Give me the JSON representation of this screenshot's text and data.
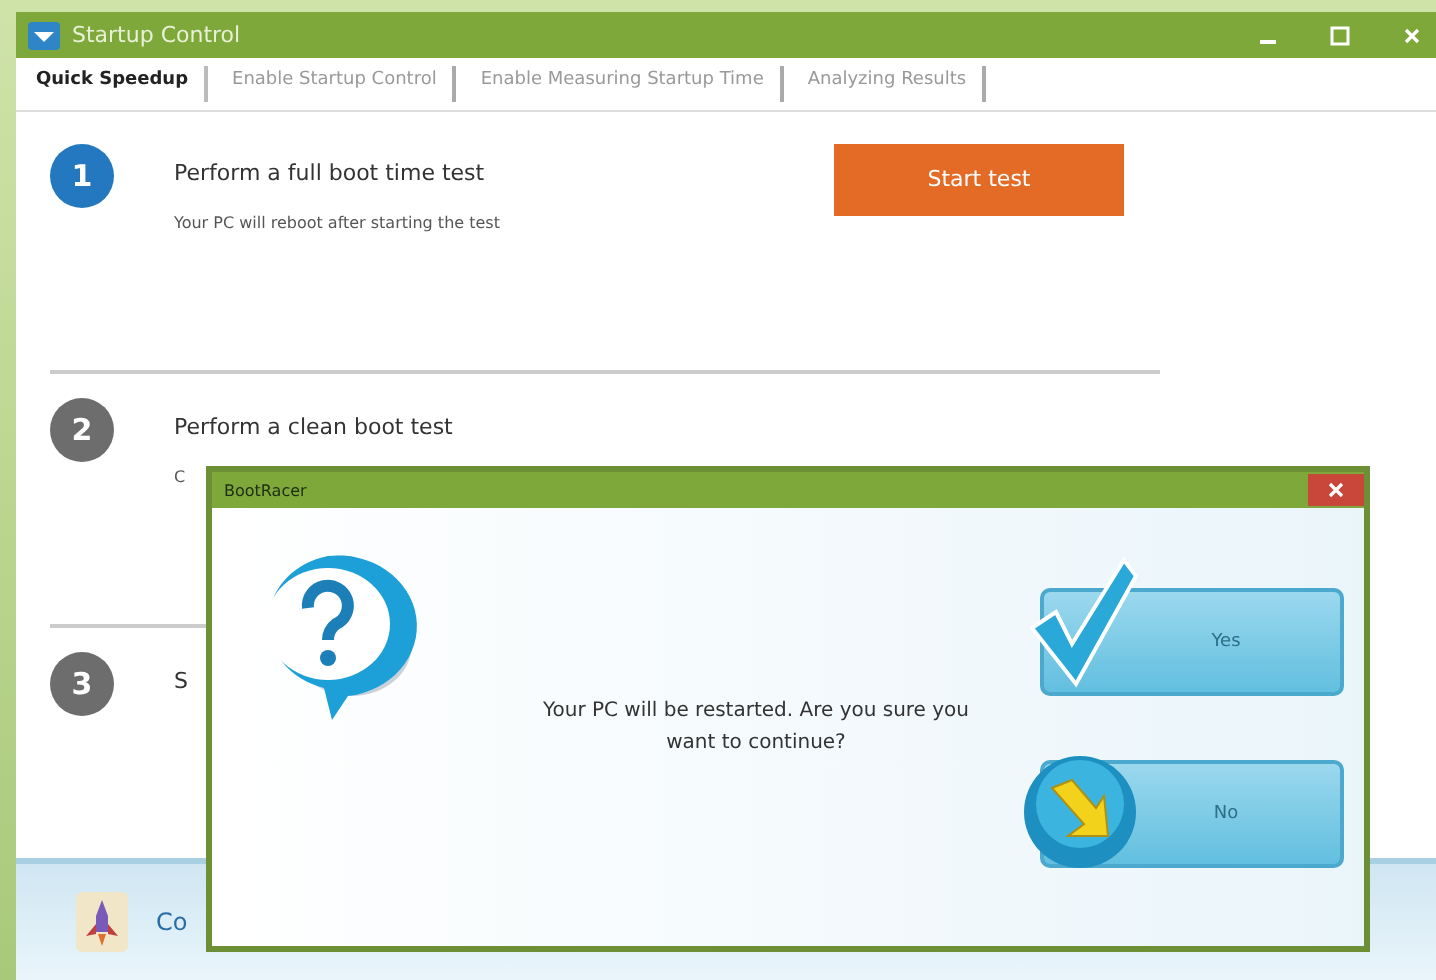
{
  "window": {
    "title": "Startup Control"
  },
  "tabs": [
    {
      "label": "Quick Speedup",
      "selected": true
    },
    {
      "label": "Enable Startup Control",
      "selected": false
    },
    {
      "label": "Enable Measuring Startup Time",
      "selected": false
    },
    {
      "label": "Analyzing Results",
      "selected": false
    }
  ],
  "steps": [
    {
      "number": "1",
      "active": true,
      "title": "Perform a full boot time test",
      "description": "Your PC will reboot after starting the test",
      "button": "Start test"
    },
    {
      "number": "2",
      "active": false,
      "title": "Perform a clean boot test",
      "description": "C"
    },
    {
      "number": "3",
      "active": false,
      "title": "S"
    }
  ],
  "footer": {
    "text": "Co"
  },
  "dialog": {
    "title": "BootRacer",
    "message": "Your PC will be restarted. Are you sure you want to continue?",
    "buttons": [
      {
        "label": "Yes",
        "kind": "yes"
      },
      {
        "label": "No",
        "kind": "no"
      }
    ]
  }
}
